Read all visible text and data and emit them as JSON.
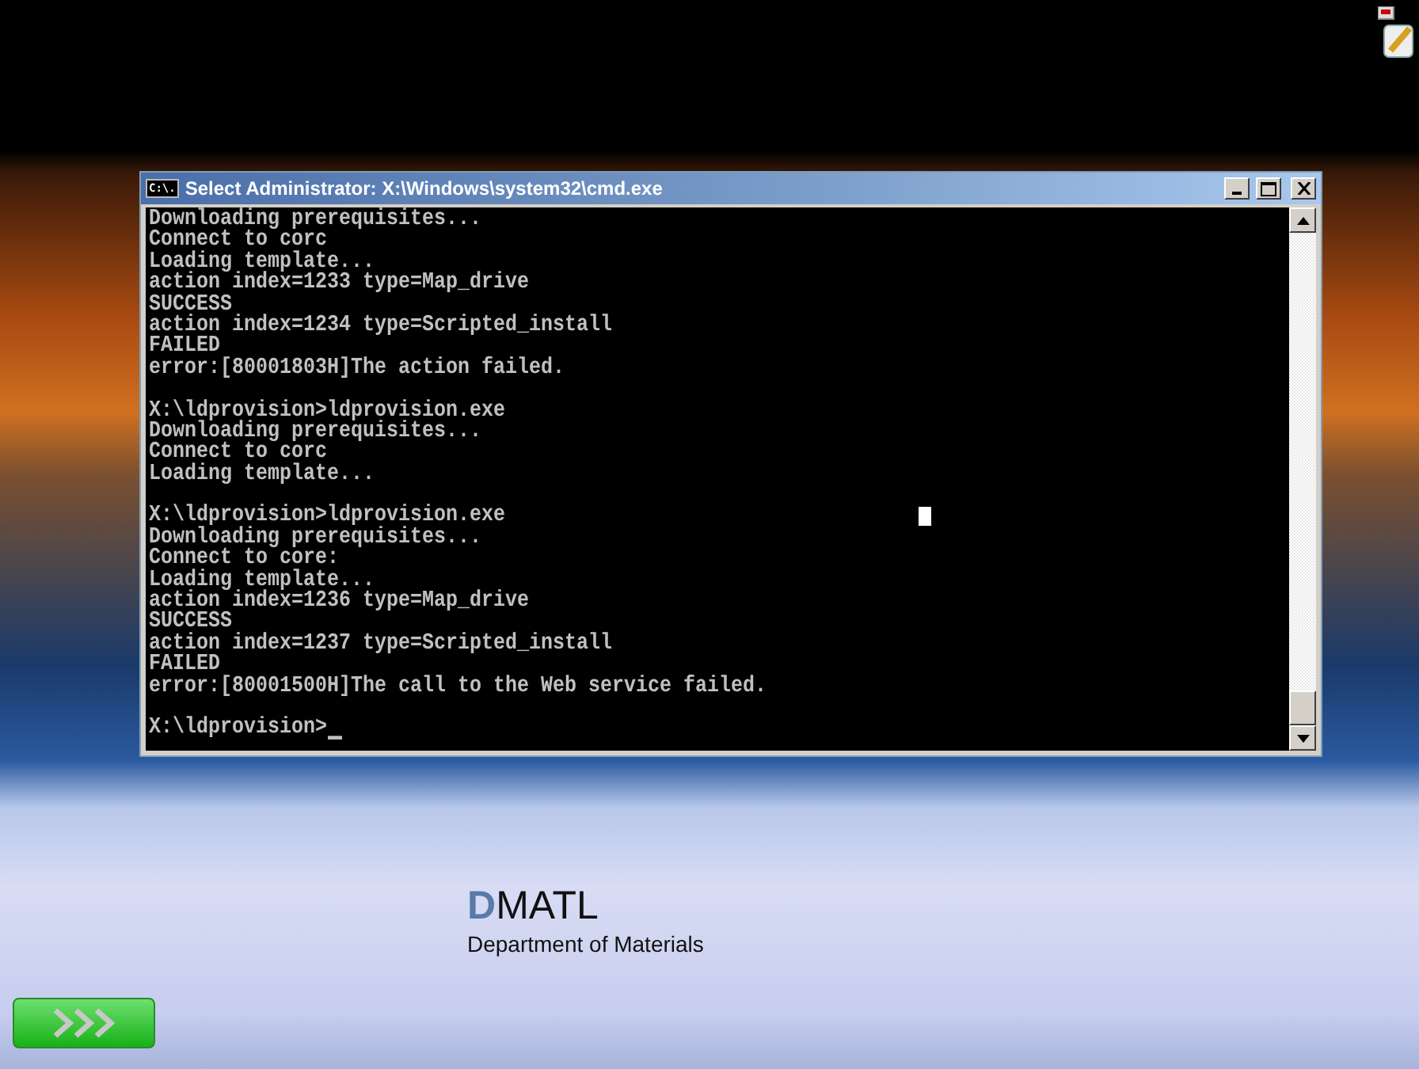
{
  "window": {
    "title": "Select Administrator: X:\\Windows\\system32\\cmd.exe",
    "icon_text": "C:\\."
  },
  "console": {
    "blocks": [
      {
        "lines": [
          "Downloading prerequisites...",
          "Connect to corc",
          "Loading template...",
          "action index=1233 type=Map_drive",
          "SUCCESS",
          "action index=1234 type=Scripted_install",
          "FAILED",
          "error:[80001803H]The action failed."
        ]
      },
      {
        "lines": [
          "X:\\ldprovision>ldprovision.exe",
          "Downloading prerequisites...",
          "Connect to corc",
          "Loading template..."
        ]
      },
      {
        "lines": [
          "X:\\ldprovision>ldprovision.exe",
          "Downloading prerequisites...",
          "Connect to core:",
          "Loading template...",
          "action index=1236 type=Map_drive",
          "SUCCESS",
          "action index=1237 type=Scripted_install",
          "FAILED",
          "error:[80001500H]The call to the Web service failed."
        ]
      },
      {
        "lines": [
          "X:\\ldprovision>"
        ],
        "cursor": true
      }
    ]
  },
  "branding": {
    "mark": "D",
    "title": "MATL",
    "subtitle": "Department of Materials"
  }
}
